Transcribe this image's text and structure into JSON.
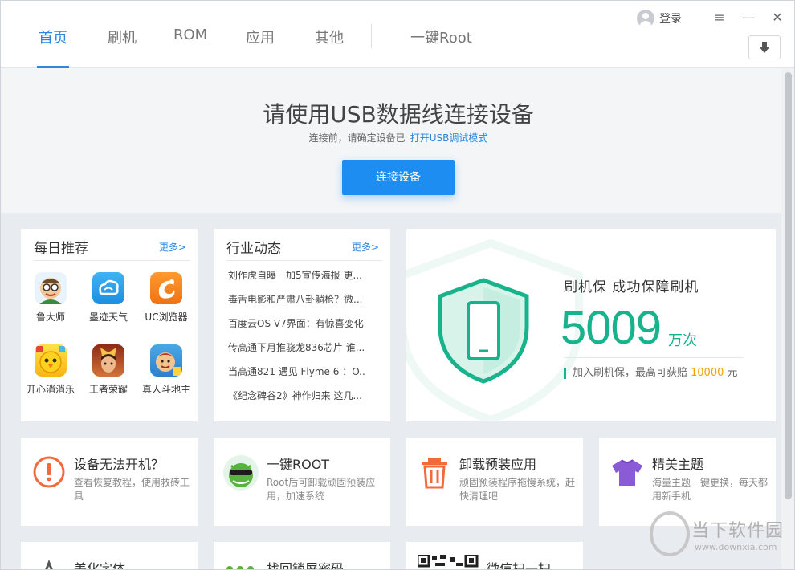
{
  "nav": {
    "tabs": [
      {
        "label": "首页"
      },
      {
        "label": "刷机"
      },
      {
        "label": "ROM"
      },
      {
        "label": "应用"
      },
      {
        "label": "其他"
      },
      {
        "label": "一键Root"
      }
    ],
    "login_label": "登录",
    "menu_glyph": "≡",
    "minimize_glyph": "—",
    "close_glyph": "✕"
  },
  "hero": {
    "title": "请使用USB数据线连接设备",
    "subtitle": "连接前，请确定设备已",
    "subtitle_link": "打开USB调试模式",
    "button": "连接设备"
  },
  "daily": {
    "title": "每日推荐",
    "more": "更多>",
    "apps": [
      {
        "label": "鲁大师",
        "icon": "ludashi-icon"
      },
      {
        "label": "墨迹天气",
        "icon": "moji-weather-icon"
      },
      {
        "label": "UC浏览器",
        "icon": "uc-browser-icon"
      },
      {
        "label": "开心消消乐",
        "icon": "happy-elimination-icon"
      },
      {
        "label": "王者荣耀",
        "icon": "honor-of-kings-icon"
      },
      {
        "label": "真人斗地主",
        "icon": "doudizhu-icon"
      }
    ]
  },
  "news": {
    "title": "行业动态",
    "more": "更多>",
    "items": [
      "刘作虎自曝一加5宣传海报 更...",
      "毒舌电影和严肃八卦躺枪？微...",
      "百度云OS V7界面：有惊喜变化",
      "传高通下月推骁龙836芯片 谁...",
      "当高通821 遇见 Flyme 6 ：O...",
      "《纪念碑谷2》神作归来 这几..."
    ]
  },
  "promo": {
    "title": "刷机保  成功保障刷机",
    "number": "5009",
    "unit": "万次",
    "note_prefix": "加入刷机保，最高可获赔",
    "note_amount": "10000",
    "note_suffix": "元"
  },
  "features": [
    {
      "title": "设备无法开机？",
      "desc": "查看恢复教程，使用救砖工具",
      "icon": "warning-icon"
    },
    {
      "title": "一键ROOT",
      "desc": "Root后可卸载顽固预装应用，加速系统",
      "icon": "root-mascot-icon"
    },
    {
      "title": "卸载预装应用",
      "desc": "顽固预装程序拖慢系统，赶快清理吧",
      "icon": "trash-icon"
    },
    {
      "title": "精美主题",
      "desc": "海量主题一键更换，每天都用新手机",
      "icon": "tshirt-icon"
    }
  ],
  "bottom_row": [
    {
      "title": "美化字体"
    },
    {
      "title": "找回锁屏密码"
    },
    {
      "title": "微信扫一扫"
    }
  ],
  "watermark": {
    "main": "当下软件园",
    "sub": "www.downxia.com"
  },
  "colors": {
    "accent": "#2b86e0",
    "green": "#17b38c",
    "orange": "#f2a20c"
  }
}
